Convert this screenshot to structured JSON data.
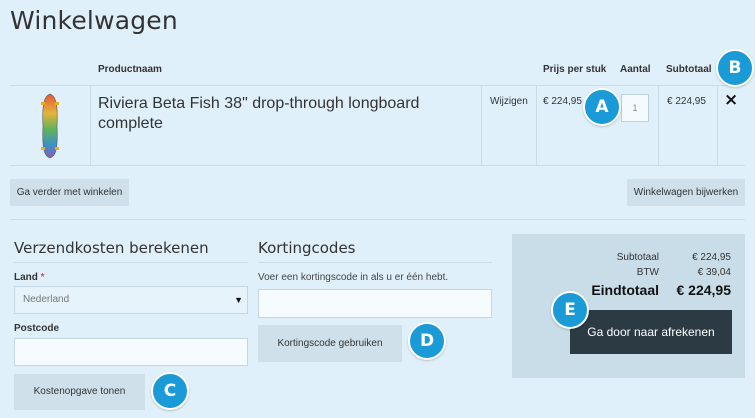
{
  "page": {
    "title": "Winkelwagen"
  },
  "cart": {
    "headers": {
      "product_name": "Productnaam",
      "unit_price": "Prijs per stuk",
      "quantity": "Aantal",
      "subtotal": "Subtotaal"
    },
    "item": {
      "name": "Riviera Beta Fish 38\" drop-through longboard complete",
      "edit_label": "Wijzigen",
      "unit_price": "€ 224,95",
      "quantity": "1",
      "subtotal": "€ 224,95",
      "remove_label": "×"
    },
    "continue_label": "Ga verder met winkelen",
    "update_label": "Winkelwagen bijwerken"
  },
  "shipping": {
    "title": "Verzendkosten berekenen",
    "country_label": "Land",
    "required_mark": "*",
    "country_value": "Nederland",
    "postcode_label": "Postcode",
    "postcode_value": "",
    "estimate_label": "Kostenopgave tonen"
  },
  "discount": {
    "title": "Kortingcodes",
    "hint": "Voer een kortingscode in als u er één hebt.",
    "code_value": "",
    "apply_label": "Kortingscode gebruiken"
  },
  "totals": {
    "subtotal_label": "Subtotaal",
    "subtotal_value": "€ 224,95",
    "vat_label": "BTW",
    "vat_value": "€ 39,04",
    "grand_label": "Eindtotaal",
    "grand_value": "€ 224,95",
    "checkout_label": "Ga door naar afrekenen"
  },
  "annotations": {
    "a": "A",
    "b": "B",
    "c": "C",
    "d": "D",
    "e": "E",
    "color": "#1a9ad6"
  }
}
